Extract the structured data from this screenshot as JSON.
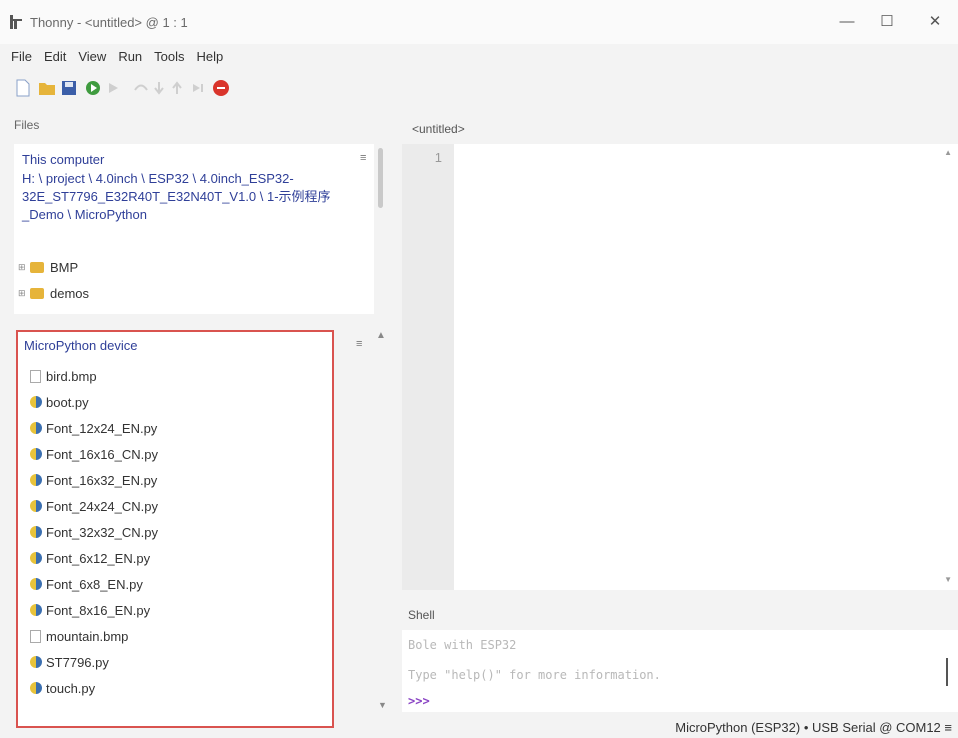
{
  "window": {
    "title": "Thonny - <untitled> @ 1 : 1",
    "minimize": "—",
    "maximize": "☐",
    "close": "✕"
  },
  "menu": [
    "File",
    "Edit",
    "View",
    "Run",
    "Tools",
    "Help"
  ],
  "toolbar": {
    "icons": [
      "new-file",
      "open-file",
      "save-file",
      "run",
      "debug",
      "step-over",
      "step-into",
      "step-out",
      "resume",
      "stop"
    ]
  },
  "files": {
    "tab": "Files",
    "computer_title": "This computer",
    "computer_path": "H: \\ project \\ 4.0inch \\ ESP32 \\ 4.0inch_ESP32-32E_ST7796_E32R40T_E32N40T_V1.0 \\ 1-示例程序_Demo \\ MicroPython",
    "folders": [
      "BMP",
      "demos"
    ],
    "device_title": "MicroPython device",
    "device_files": [
      {
        "name": "bird.bmp",
        "type": "bmp"
      },
      {
        "name": "boot.py",
        "type": "py"
      },
      {
        "name": "Font_12x24_EN.py",
        "type": "py"
      },
      {
        "name": "Font_16x16_CN.py",
        "type": "py"
      },
      {
        "name": "Font_16x32_EN.py",
        "type": "py"
      },
      {
        "name": "Font_24x24_CN.py",
        "type": "py"
      },
      {
        "name": "Font_32x32_CN.py",
        "type": "py"
      },
      {
        "name": "Font_6x12_EN.py",
        "type": "py"
      },
      {
        "name": "Font_6x8_EN.py",
        "type": "py"
      },
      {
        "name": "Font_8x16_EN.py",
        "type": "py"
      },
      {
        "name": "mountain.bmp",
        "type": "bmp"
      },
      {
        "name": "ST7796.py",
        "type": "py"
      },
      {
        "name": "touch.py",
        "type": "py"
      }
    ]
  },
  "editor": {
    "tab": "<untitled>",
    "line_number": "1"
  },
  "shell": {
    "tab": "Shell",
    "line1": "Bole with ESP32",
    "line2": "Type \"help()\" for more information.",
    "prompt": ">>>"
  },
  "status": "MicroPython (ESP32)  •  USB Serial @ COM12  ≡",
  "colors": {
    "highlight_border": "#d9534f",
    "path_text": "#2f3f98",
    "prompt": "#8a44c4"
  }
}
